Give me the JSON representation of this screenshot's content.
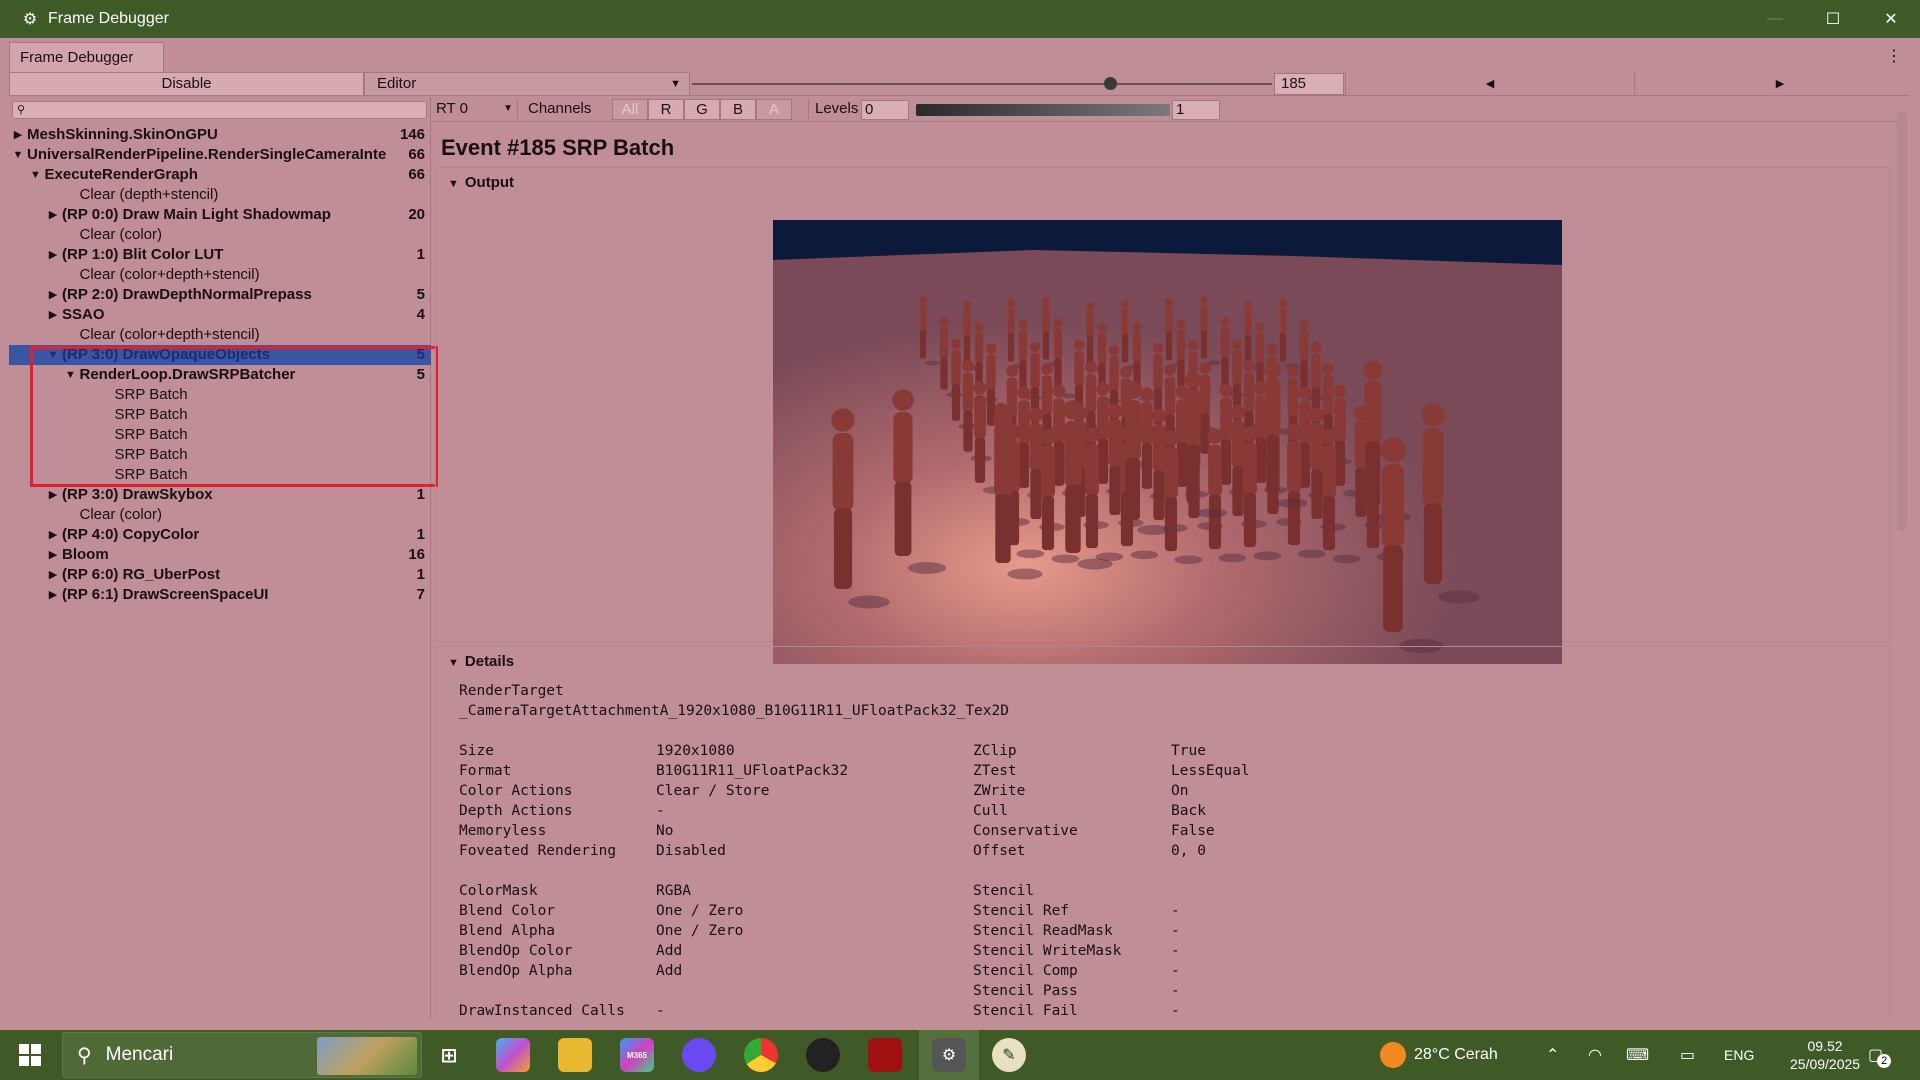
{
  "window": {
    "title": "Frame Debugger",
    "minimize": "—",
    "maximize": "☐",
    "close": "✕"
  },
  "tab": {
    "label": "Frame Debugger",
    "menu": "⋮"
  },
  "toolbar": {
    "disable_label": "Disable",
    "target_dropdown": "Editor",
    "event_value": "185",
    "event_fraction": 0.72
  },
  "tree": [
    {
      "label": "MeshSkinning.SkinOnGPU",
      "count": "146",
      "indent": 0,
      "arrow": "▶",
      "bold": true
    },
    {
      "label": "UniversalRenderPipeline.RenderSingleCameraInte",
      "count": "66",
      "indent": 0,
      "arrow": "▼",
      "bold": true
    },
    {
      "label": "ExecuteRenderGraph",
      "count": "66",
      "indent": 1,
      "arrow": "▼",
      "bold": true
    },
    {
      "label": "Clear (depth+stencil)",
      "count": "",
      "indent": 3,
      "arrow": "",
      "bold": false
    },
    {
      "label": "(RP 0:0) Draw Main Light Shadowmap",
      "count": "20",
      "indent": 2,
      "arrow": "▶",
      "bold": true
    },
    {
      "label": "Clear (color)",
      "count": "",
      "indent": 3,
      "arrow": "",
      "bold": false
    },
    {
      "label": "(RP 1:0) Blit Color LUT",
      "count": "1",
      "indent": 2,
      "arrow": "▶",
      "bold": true
    },
    {
      "label": "Clear (color+depth+stencil)",
      "count": "",
      "indent": 3,
      "arrow": "",
      "bold": false
    },
    {
      "label": "(RP 2:0) DrawDepthNormalPrepass",
      "count": "5",
      "indent": 2,
      "arrow": "▶",
      "bold": true
    },
    {
      "label": "SSAO",
      "count": "4",
      "indent": 2,
      "arrow": "▶",
      "bold": true
    },
    {
      "label": "Clear (color+depth+stencil)",
      "count": "",
      "indent": 3,
      "arrow": "",
      "bold": false
    },
    {
      "label": "(RP 3:0) DrawOpaqueObjects",
      "count": "5",
      "indent": 2,
      "arrow": "▼",
      "bold": true,
      "selected": true
    },
    {
      "label": "RenderLoop.DrawSRPBatcher",
      "count": "5",
      "indent": 3,
      "arrow": "▼",
      "bold": true
    },
    {
      "label": "SRP Batch",
      "count": "",
      "indent": 5,
      "arrow": "",
      "bold": false
    },
    {
      "label": "SRP Batch",
      "count": "",
      "indent": 5,
      "arrow": "",
      "bold": false
    },
    {
      "label": "SRP Batch",
      "count": "",
      "indent": 5,
      "arrow": "",
      "bold": false
    },
    {
      "label": "SRP Batch",
      "count": "",
      "indent": 5,
      "arrow": "",
      "bold": false
    },
    {
      "label": "SRP Batch",
      "count": "",
      "indent": 5,
      "arrow": "",
      "bold": false
    },
    {
      "label": "(RP 3:0) DrawSkybox",
      "count": "1",
      "indent": 2,
      "arrow": "▶",
      "bold": true
    },
    {
      "label": "Clear (color)",
      "count": "",
      "indent": 3,
      "arrow": "",
      "bold": false
    },
    {
      "label": "(RP 4:0) CopyColor",
      "count": "1",
      "indent": 2,
      "arrow": "▶",
      "bold": true
    },
    {
      "label": "Bloom",
      "count": "16",
      "indent": 2,
      "arrow": "▶",
      "bold": true
    },
    {
      "label": "(RP 6:0) RG_UberPost",
      "count": "1",
      "indent": 2,
      "arrow": "▶",
      "bold": true
    },
    {
      "label": "(RP 6:1) DrawScreenSpaceUI",
      "count": "7",
      "indent": 2,
      "arrow": "▶",
      "bold": true
    }
  ],
  "view_toolbar": {
    "rt": "RT 0",
    "channels_label": "Channels",
    "channels": [
      "All",
      "R",
      "G",
      "B",
      "A"
    ],
    "levels_label": "Levels",
    "levels_min": "0",
    "levels_max": "1"
  },
  "event_title": "Event #185 SRP Batch",
  "output_label": "Output",
  "details_label": "Details",
  "details": {
    "rt_label": "RenderTarget",
    "rt_name": "_CameraTargetAttachmentA_1920x1080_B10G11R11_UFloatPack32_Tex2D",
    "rows": [
      [
        "Size",
        "1920x1080",
        "ZClip",
        "True"
      ],
      [
        "Format",
        "B10G11R11_UFloatPack32",
        "ZTest",
        "LessEqual"
      ],
      [
        "Color Actions",
        "Clear / Store",
        "ZWrite",
        "On"
      ],
      [
        "Depth Actions",
        "-",
        "Cull",
        "Back"
      ],
      [
        "Memoryless",
        "No",
        "Conservative",
        "False"
      ],
      [
        "Foveated Rendering",
        "Disabled",
        "Offset",
        "0, 0"
      ],
      [
        "",
        "",
        "",
        ""
      ],
      [
        "ColorMask",
        "RGBA",
        "Stencil",
        ""
      ],
      [
        "Blend Color",
        "One / Zero",
        "Stencil Ref",
        "-"
      ],
      [
        "Blend Alpha",
        "One / Zero",
        "Stencil ReadMask",
        "-"
      ],
      [
        "BlendOp Color",
        "Add",
        "Stencil WriteMask",
        "-"
      ],
      [
        "BlendOp Alpha",
        "Add",
        "Stencil Comp",
        "-"
      ],
      [
        "",
        "",
        "Stencil Pass",
        "-"
      ],
      [
        "DrawInstanced Calls",
        "-",
        "Stencil Fail",
        "-"
      ]
    ]
  },
  "taskbar": {
    "search_placeholder": "Mencari",
    "weather": "28°C  Cerah",
    "lang": "ENG",
    "time": "09.52",
    "date": "25/09/2025",
    "notif_count": "2",
    "m365_badge": "M365"
  },
  "colors": {
    "accent_red": "#e3202d",
    "selection": "#3a56a0",
    "titlebar": "#3e5a26"
  }
}
